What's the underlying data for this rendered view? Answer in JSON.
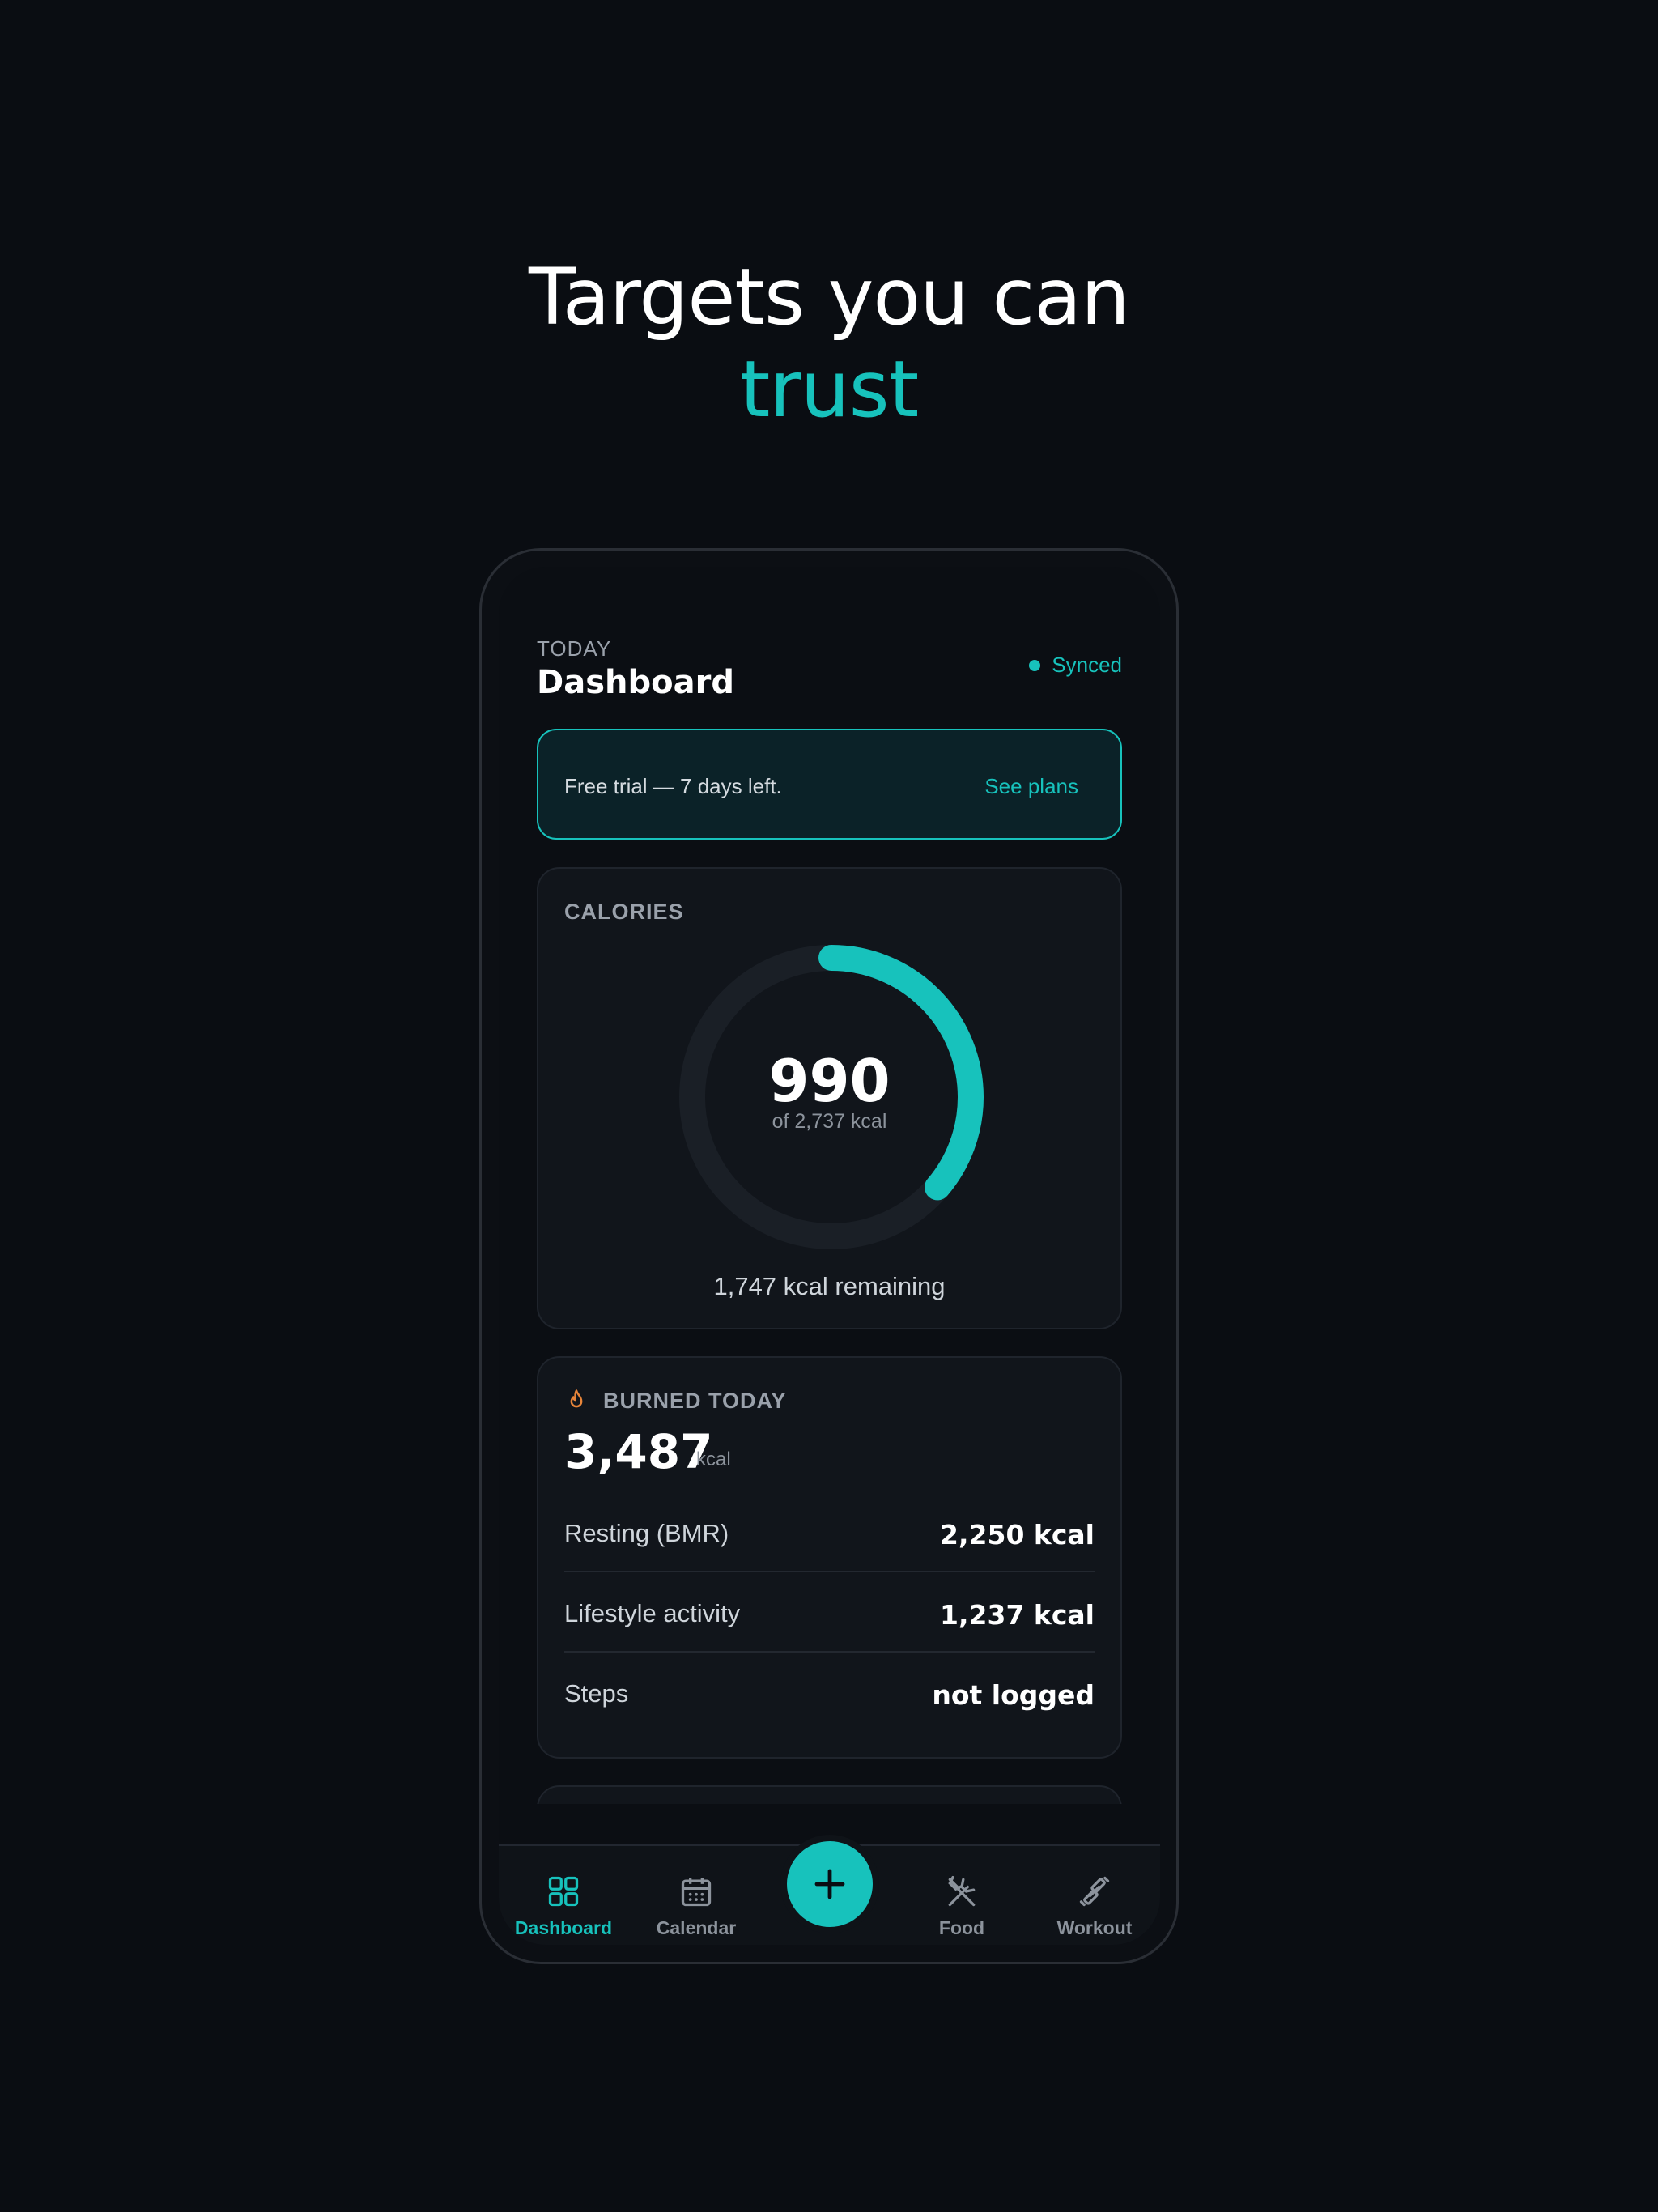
{
  "headline": {
    "line1": "Targets you can",
    "line2": "trust"
  },
  "colors": {
    "accent": "#17c2bc",
    "background": "#0a0d12",
    "card": "#11151b",
    "flame": "#e8853a"
  },
  "header": {
    "eyebrow": "TODAY",
    "title": "Dashboard",
    "sync_status": "Synced"
  },
  "trial_banner": {
    "message": "Free trial — 7 days left.",
    "link": "See plans"
  },
  "calories": {
    "label": "CALORIES",
    "consumed": "990",
    "target_text": "of 2,737 kcal",
    "remaining_text": "1,747 kcal remaining",
    "progress": 0.362
  },
  "burned": {
    "icon": "flame-icon",
    "label": "BURNED TODAY",
    "total": "3,487",
    "unit": "kcal",
    "rows": [
      {
        "label": "Resting (BMR)",
        "value": "2,250 kcal"
      },
      {
        "label": "Lifestyle activity",
        "value": "1,237 kcal"
      },
      {
        "label": "Steps",
        "value": "not logged"
      }
    ]
  },
  "tabbar": {
    "tabs": [
      {
        "label": "Dashboard",
        "icon": "grid-icon",
        "active": true
      },
      {
        "label": "Calendar",
        "icon": "calendar-icon",
        "active": false
      },
      {
        "label": "Food",
        "icon": "utensils-icon",
        "active": false
      },
      {
        "label": "Workout",
        "icon": "dumbbell-icon",
        "active": false
      }
    ],
    "fab_icon": "plus-icon"
  }
}
